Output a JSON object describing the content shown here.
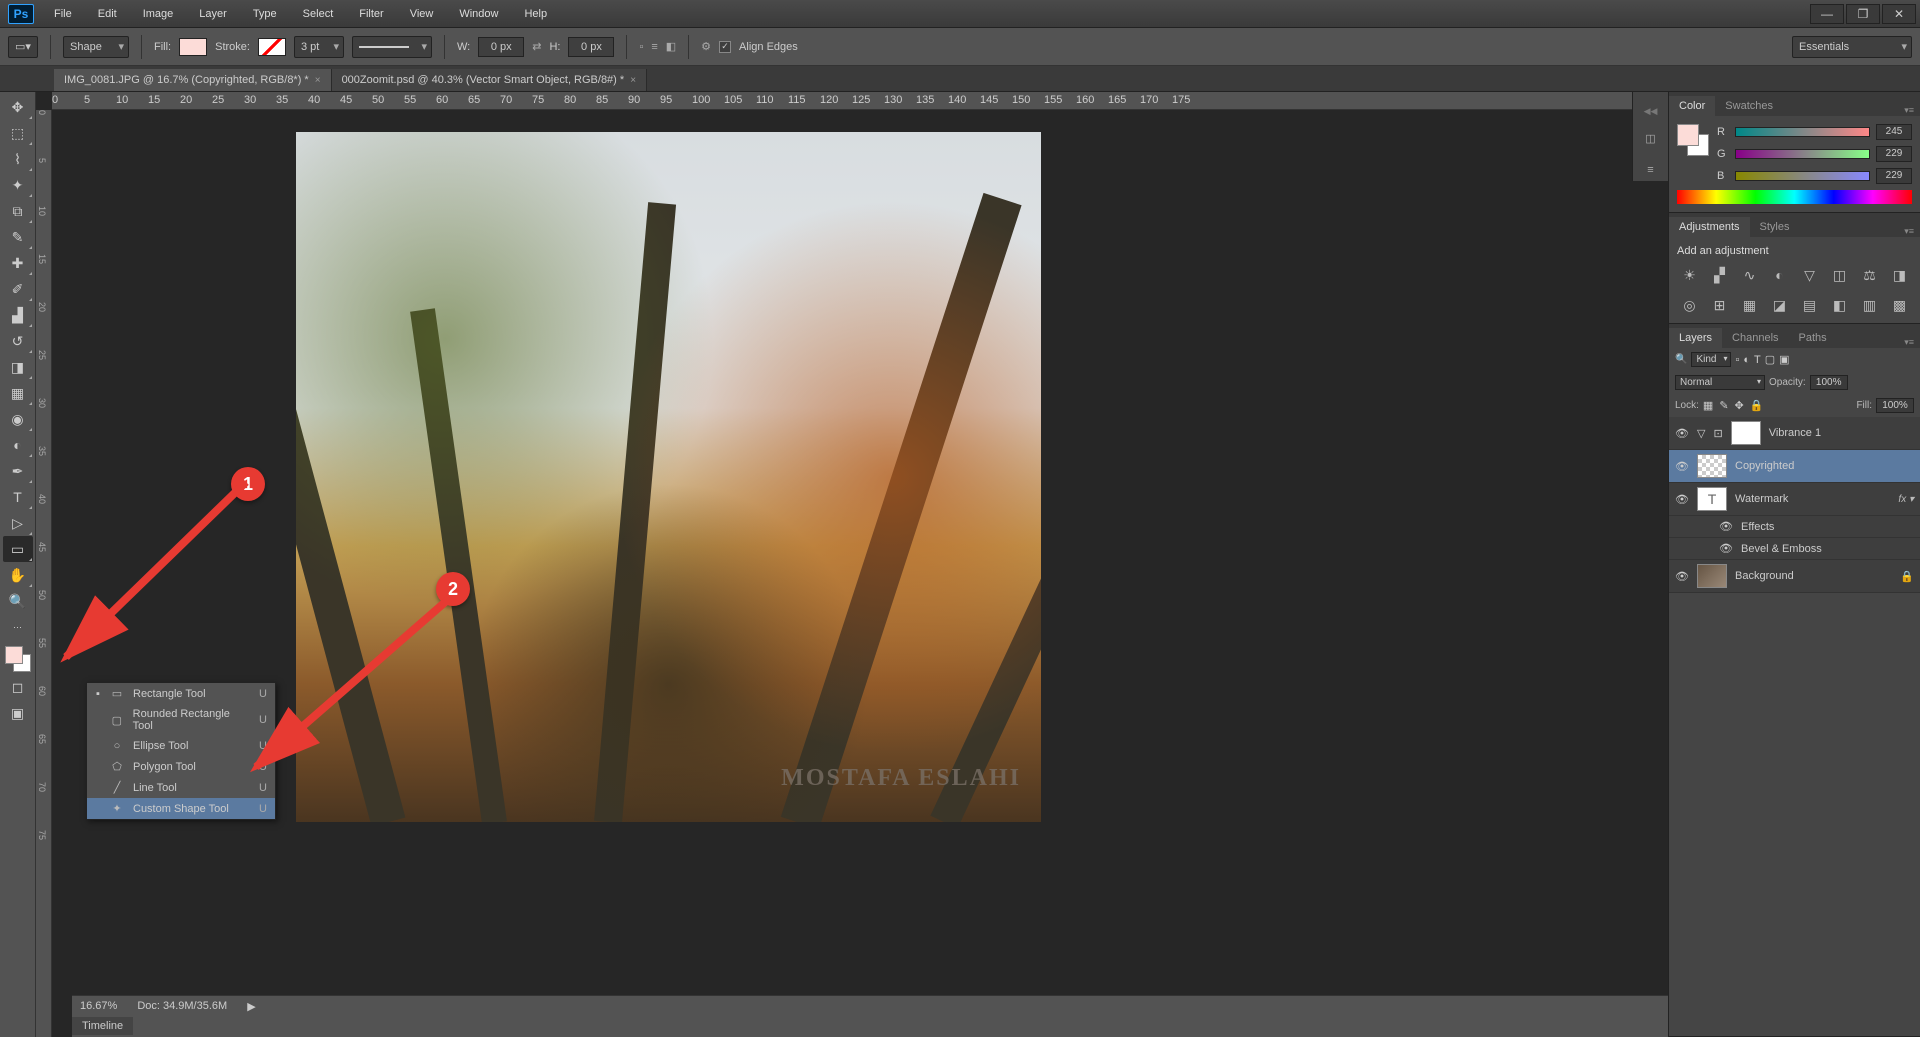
{
  "menubar": [
    "File",
    "Edit",
    "Image",
    "Layer",
    "Type",
    "Select",
    "Filter",
    "View",
    "Window",
    "Help"
  ],
  "optionsbar": {
    "mode": "Shape",
    "fill_label": "Fill:",
    "fill_color": "#fcdcd8",
    "stroke_label": "Stroke:",
    "stroke_width": "3 pt",
    "w_label": "W:",
    "w_val": "0 px",
    "h_label": "H:",
    "h_val": "0 px",
    "align_label": "Align Edges"
  },
  "workspace": "Essentials",
  "tabs": [
    {
      "label": "IMG_0081.JPG @ 16.7% (Copyrighted, RGB/8*) *",
      "active": true
    },
    {
      "label": "000Zoomit.psd @ 40.3% (Vector Smart Object, RGB/8#) *",
      "active": false
    }
  ],
  "ruler_h": [
    "0",
    "5",
    "10",
    "15",
    "20",
    "25",
    "30",
    "35",
    "40",
    "45",
    "50",
    "55",
    "60",
    "65",
    "70",
    "75",
    "80",
    "85",
    "90",
    "95",
    "100",
    "105",
    "110",
    "115",
    "120",
    "125",
    "130",
    "135",
    "140",
    "145",
    "150",
    "155",
    "160",
    "165",
    "170",
    "175"
  ],
  "ruler_v": [
    "0",
    "5",
    "10",
    "15",
    "20",
    "25",
    "30",
    "35",
    "40",
    "45",
    "50",
    "55",
    "60",
    "65",
    "70",
    "75"
  ],
  "watermark": "MOSTAFA ESLAHI",
  "flyout": [
    {
      "label": "Rectangle Tool",
      "key": "U",
      "active": true
    },
    {
      "label": "Rounded Rectangle Tool",
      "key": "U"
    },
    {
      "label": "Ellipse Tool",
      "key": "U"
    },
    {
      "label": "Polygon Tool",
      "key": "U"
    },
    {
      "label": "Line Tool",
      "key": "U"
    },
    {
      "label": "Custom Shape Tool",
      "key": "U",
      "hl": true
    }
  ],
  "markers": {
    "m1": "1",
    "m2": "2"
  },
  "status": {
    "zoom": "16.67%",
    "doc": "Doc: 34.9M/35.6M",
    "timeline": "Timeline"
  },
  "color_panel": {
    "tabs": [
      "Color",
      "Swatches"
    ],
    "r": "245",
    "g": "229",
    "b": "229"
  },
  "adjustments_panel": {
    "tabs": [
      "Adjustments",
      "Styles"
    ],
    "title": "Add an adjustment"
  },
  "layers_panel": {
    "tabs": [
      "Layers",
      "Channels",
      "Paths"
    ],
    "kind": "Kind",
    "blend": "Normal",
    "opacity_lbl": "Opacity:",
    "opacity": "100%",
    "lock_lbl": "Lock:",
    "fill_lbl": "Fill:",
    "fill": "100%",
    "layers": [
      {
        "name": "Vibrance 1",
        "type": "adj"
      },
      {
        "name": "Copyrighted",
        "type": "normal",
        "selected": true
      },
      {
        "name": "Watermark",
        "type": "text",
        "fx": true
      },
      {
        "name": "Effects",
        "type": "sub"
      },
      {
        "name": "Bevel & Emboss",
        "type": "sub"
      },
      {
        "name": "Background",
        "type": "bg",
        "locked": true
      }
    ]
  }
}
